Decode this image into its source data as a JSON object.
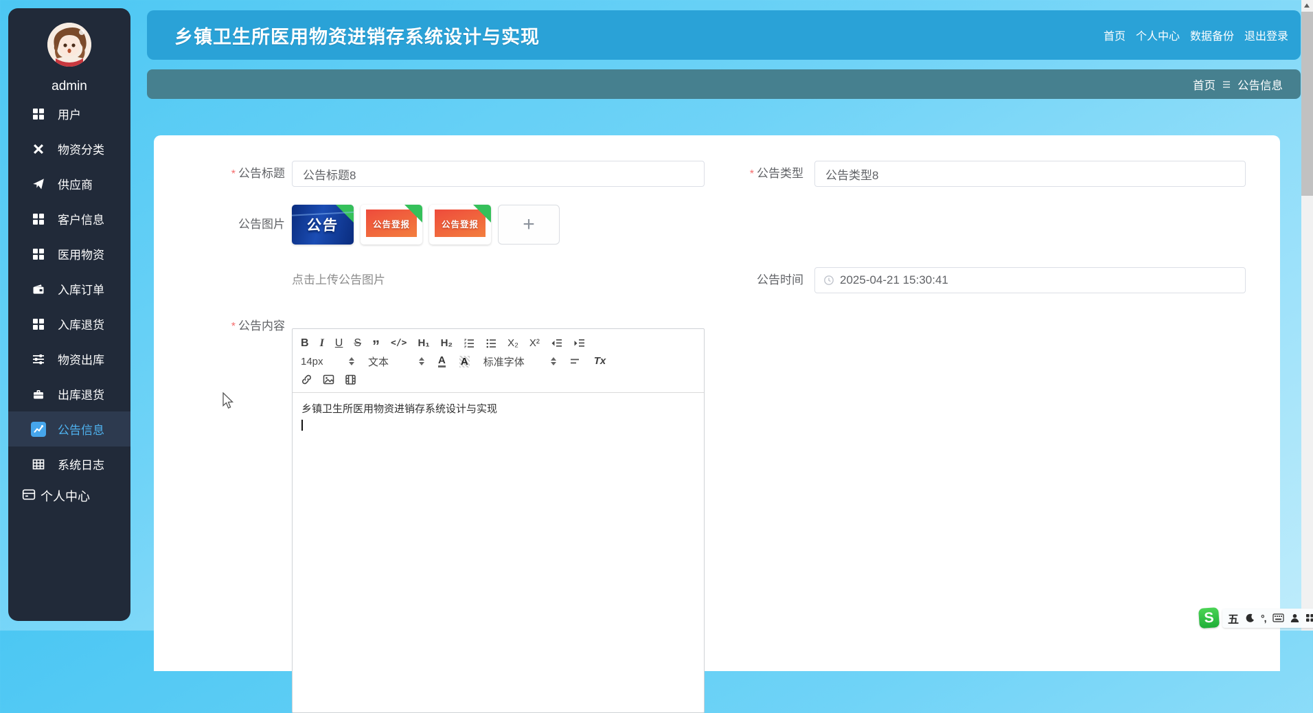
{
  "app": {
    "title": "乡镇卫生所医用物资进销存系统设计与实现"
  },
  "header": {
    "nav": [
      {
        "label": "首页"
      },
      {
        "label": "个人中心"
      },
      {
        "label": "数据备份"
      },
      {
        "label": "退出登录"
      }
    ]
  },
  "breadcrumb": {
    "home": "首页",
    "current": "公告信息"
  },
  "sidebar": {
    "username": "admin",
    "items": [
      {
        "label": "用户",
        "icon": "grid-icon"
      },
      {
        "label": "物资分类",
        "icon": "category-icon"
      },
      {
        "label": "供应商",
        "icon": "send-icon"
      },
      {
        "label": "客户信息",
        "icon": "grid-icon"
      },
      {
        "label": "医用物资",
        "icon": "grid-icon"
      },
      {
        "label": "入库订单",
        "icon": "wallet-icon"
      },
      {
        "label": "入库退货",
        "icon": "grid-icon"
      },
      {
        "label": "物资出库",
        "icon": "sliders-icon"
      },
      {
        "label": "出库退货",
        "icon": "briefcase-icon"
      },
      {
        "label": "公告信息",
        "icon": "chart-icon",
        "active": true
      },
      {
        "label": "系统日志",
        "icon": "table-icon"
      }
    ],
    "footer_item": {
      "label": "个人中心",
      "icon": "window-icon"
    }
  },
  "form": {
    "required_mark": "*",
    "title": {
      "label": "公告标题",
      "value": "公告标题8"
    },
    "type": {
      "label": "公告类型",
      "value": "公告类型8"
    },
    "image": {
      "label": "公告图片",
      "hint": "点击上传公告图片",
      "add": "+",
      "thumbs": [
        {
          "text": "公告"
        },
        {
          "text": "公告登报"
        },
        {
          "text": "公告登报"
        }
      ]
    },
    "time": {
      "label": "公告时间",
      "value": "2025-04-21 15:30:41"
    },
    "content": {
      "label": "公告内容",
      "editor": {
        "buttons": {
          "bold": "B",
          "italic": "I",
          "underline": "U",
          "strike": "S",
          "quote": "”",
          "code": "</>",
          "h1": "H₁",
          "h2": "H₂",
          "sub": "X₂",
          "sup": "X²",
          "clear": "Tx",
          "color": "A",
          "bgcolor": "A"
        },
        "font_size": "14px",
        "format": "文本",
        "font_family": "标准字体",
        "content_line": "乡镇卫生所医用物资进销存系统设计与实现"
      }
    }
  },
  "ime": {
    "logo": "S",
    "wubi": "五",
    "punct": "°,"
  },
  "colors": {
    "header_blue": "#2aa2d7",
    "breadcrumb_teal": "#46808f",
    "sidebar_dark": "#212a39",
    "active_blue": "#4fb3f0",
    "asterisk_red": "#f56c6c",
    "ribbon_green": "#35c05a"
  }
}
